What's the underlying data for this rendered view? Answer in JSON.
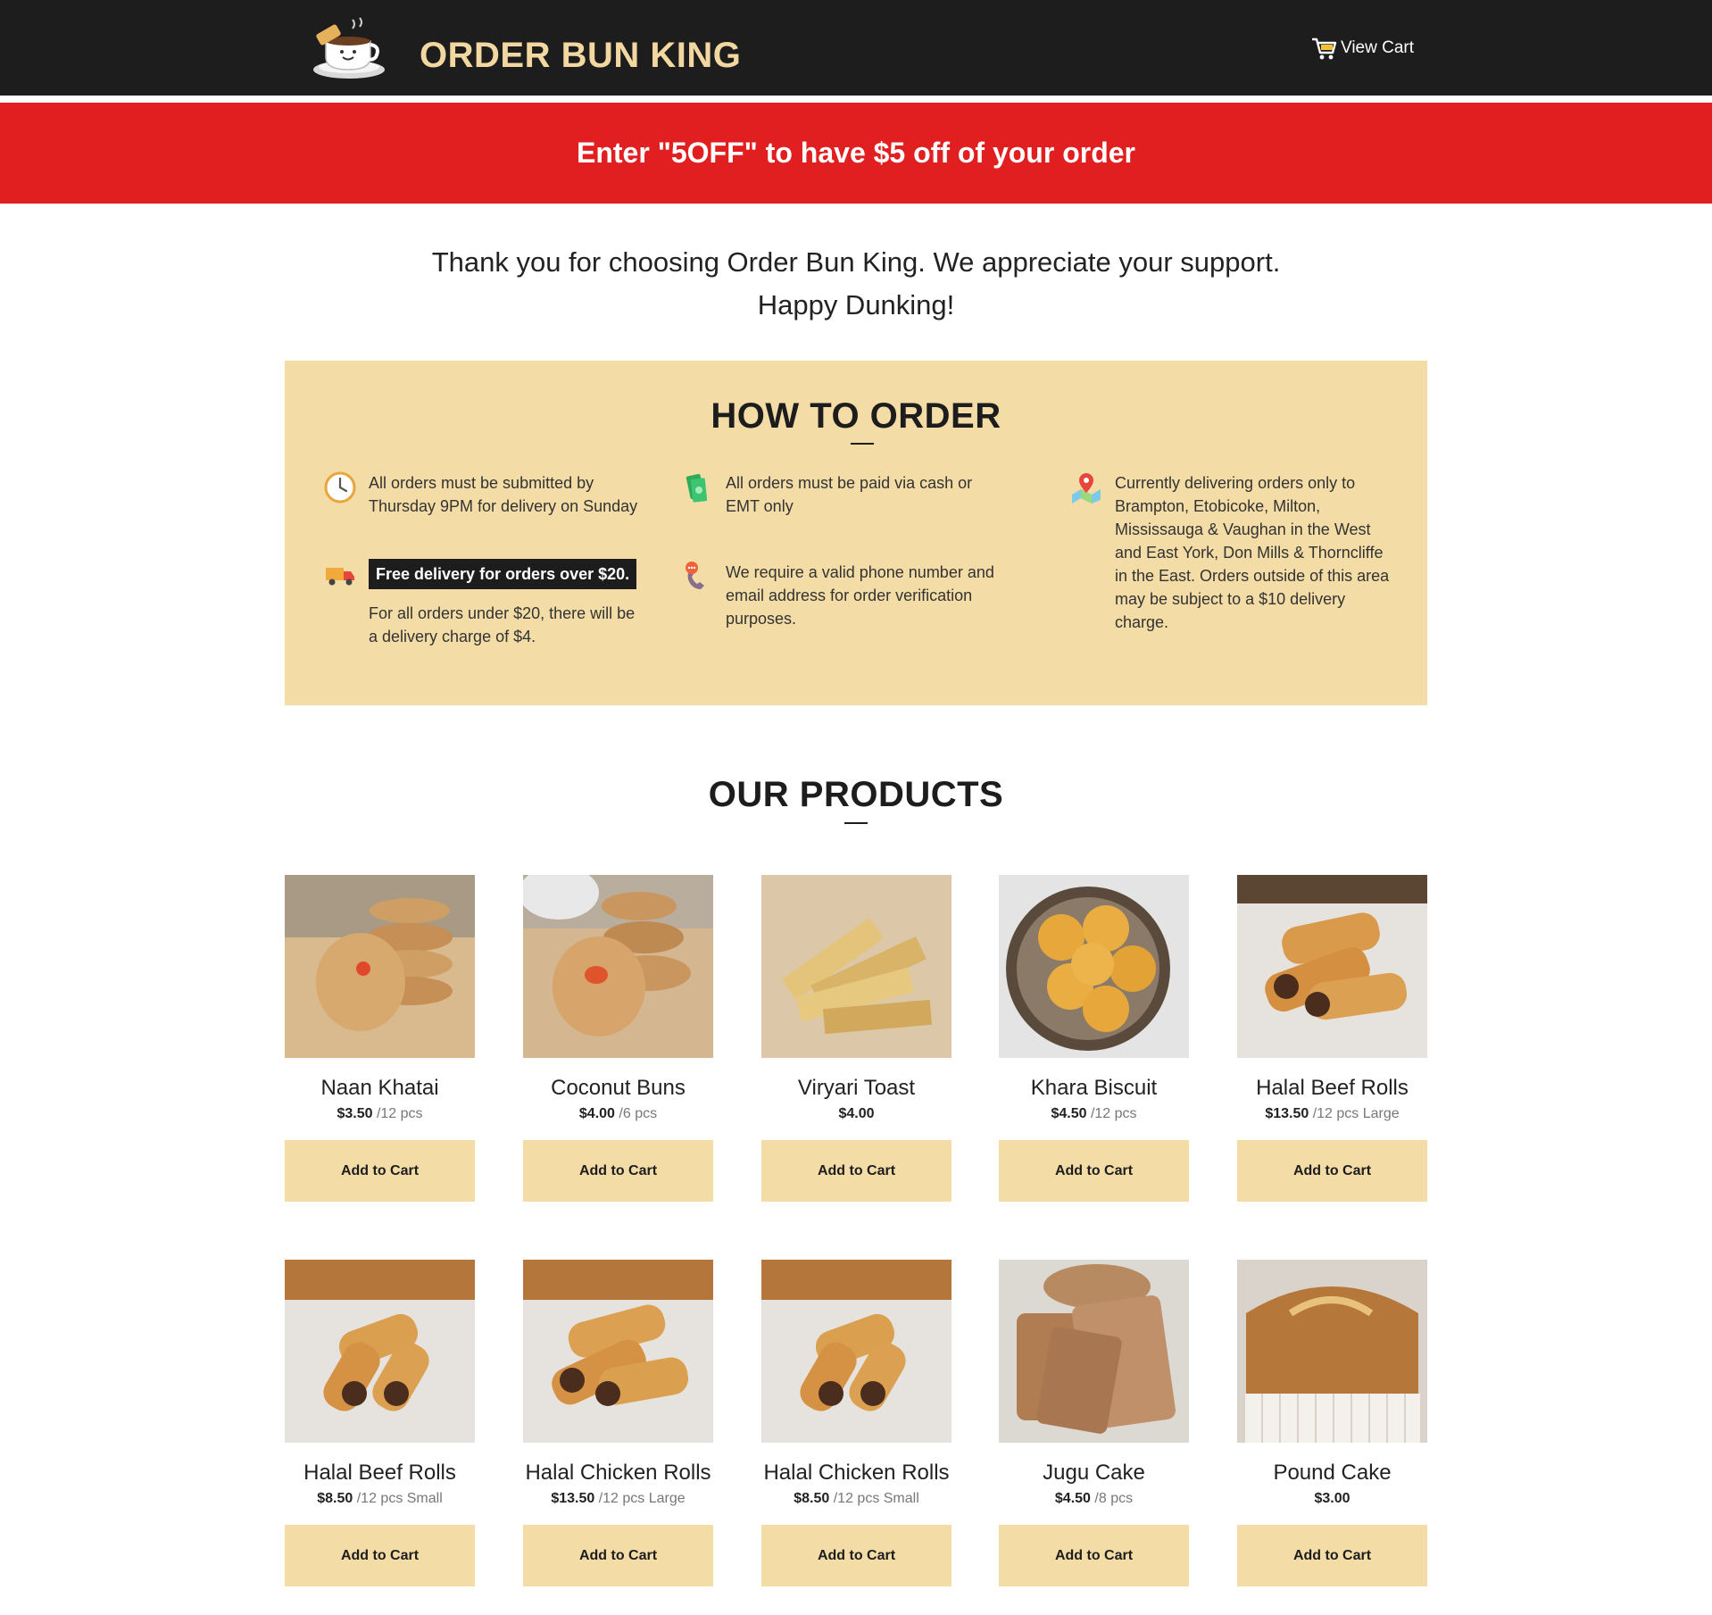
{
  "header": {
    "brand": "ORDER BUN KING",
    "cart_label": "View Cart",
    "logo_icon": "coffee-cup-icon",
    "cart_icon": "shopping-cart-icon"
  },
  "promo": {
    "text": "Enter \"5OFF\" to have $5 off of your order"
  },
  "thanks": {
    "line1": "Thank you for choosing Order Bun King. We appreciate your support.",
    "line2": "Happy Dunking!"
  },
  "howto": {
    "title": "HOW TO ORDER",
    "items": [
      {
        "icon": "clock-icon",
        "text": "All orders must be submitted by Thursday 9PM for delivery on Sunday"
      },
      {
        "icon": "money-icon",
        "text": "All orders must be paid via cash or EMT only"
      },
      {
        "icon": "map-pin-icon",
        "text": "Currently delivering orders only to Brampton, Etobicoke, Milton, Mississauga & Vaughan in the West and East York, Don Mills & Thorncliffe in the East. Orders outside of this area may be subject to a $10 delivery charge."
      },
      {
        "icon": "delivery-truck-icon",
        "badge": "Free delivery for orders over $20.",
        "text": "For all orders under $20, there will be a delivery charge of $4."
      },
      {
        "icon": "phone-chat-icon",
        "text": "We require a valid phone number and email address for order verification purposes."
      }
    ]
  },
  "products": {
    "title": "OUR PRODUCTS",
    "button_label": "Add to Cart",
    "items": [
      {
        "name": "Naan Khatai",
        "price": "$3.50",
        "unit": " /12 pcs"
      },
      {
        "name": "Coconut Buns",
        "price": "$4.00",
        "unit": " /6 pcs"
      },
      {
        "name": "Viryari Toast",
        "price": "$4.00",
        "unit": ""
      },
      {
        "name": "Khara Biscuit",
        "price": "$4.50",
        "unit": " /12 pcs"
      },
      {
        "name": "Halal Beef Rolls",
        "price": "$13.50",
        "unit": " /12 pcs Large"
      },
      {
        "name": "Halal Beef Rolls",
        "price": "$8.50",
        "unit": " /12 pcs Small"
      },
      {
        "name": "Halal Chicken Rolls",
        "price": "$13.50",
        "unit": " /12 pcs Large"
      },
      {
        "name": "Halal Chicken Rolls",
        "price": "$8.50",
        "unit": " /12 pcs Small"
      },
      {
        "name": "Jugu Cake",
        "price": "$4.50",
        "unit": " /8 pcs"
      },
      {
        "name": "Pound Cake",
        "price": "$3.00",
        "unit": ""
      }
    ]
  },
  "colors": {
    "header_bg": "#1d1d1d",
    "brand_text": "#f2d8a0",
    "promo_bg": "#e21f20",
    "panel_bg": "#f3dca6"
  }
}
